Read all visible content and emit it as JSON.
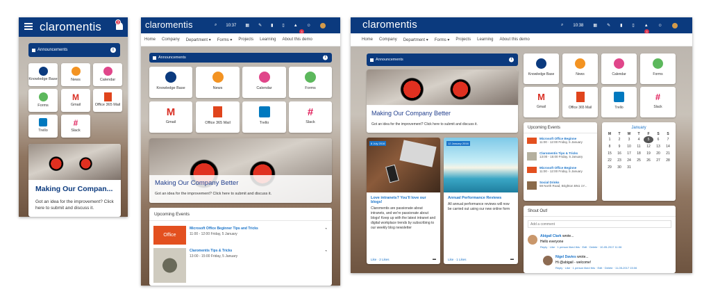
{
  "brand": "claromentis",
  "announcements": "Announcements",
  "nav": [
    "Home",
    "Company",
    "Department ▾",
    "Forms ▾",
    "Projects",
    "Learning",
    "About this demo"
  ],
  "date_label": "10:37",
  "date_label_2": "10:38",
  "apps": [
    "Knowledge Base",
    "News",
    "Calendar",
    "Forms",
    "Gmail",
    "Office 365 Mail",
    "Trello",
    "Slack"
  ],
  "mobile_hero_title": "Making Our Compan...",
  "hero_title": "Making Our Company Better",
  "hero_text": "Got an idea for the improvement? Click here to submit and discuss it.",
  "mobile_hero_text": "Got an idea for the improvement? Click here to submit and discuss it.",
  "upcoming_events": "Upcoming Events",
  "events": [
    {
      "title": "Microsoft Office Beginner Tips and Tricks",
      "time": "11:00 - 12:00 Friday, 5 January"
    },
    {
      "title": "Claromentis Tips & Tricks",
      "time": "13:00 - 15:00 Friday, 5 January"
    }
  ],
  "events_right": [
    {
      "title": "Microsoft Office Beginne",
      "time": "11:00 - 12:00 Friday, 5 January"
    },
    {
      "title": "Claromentis Tips & Tricks",
      "time": "13:00 - 15:00 Friday, 5 January"
    },
    {
      "title": "Microsoft Office Beginne",
      "time": "11:00 - 12:00 Friday, 5 January"
    },
    {
      "title": "Social Drinks",
      "time": "59 North Road, Brighton BN1 1Y..."
    }
  ],
  "office_logo": "Office",
  "calendar": {
    "month": "January",
    "days": [
      "M",
      "T",
      "W",
      "T",
      "F",
      "S",
      "S"
    ],
    "weeks": [
      [
        "1",
        "2",
        "3",
        "4",
        "5",
        "6",
        "7"
      ],
      [
        "8",
        "9",
        "10",
        "11",
        "12",
        "13",
        "14"
      ],
      [
        "15",
        "16",
        "17",
        "18",
        "19",
        "20",
        "21"
      ],
      [
        "22",
        "23",
        "24",
        "25",
        "26",
        "27",
        "28"
      ],
      [
        "29",
        "30",
        "31",
        "",
        "",
        "",
        ""
      ]
    ]
  },
  "blogs": [
    {
      "date": "8 July 2016",
      "title": "Love intranets? You'll love our blogs!",
      "text": "Claromentis are passionate about intranets, and we're passionate about blogs! Keep up with the latest intranet and digital workplace trends by subscribing to our weekly blog newsletter",
      "likes": "Like · 2 Likes"
    },
    {
      "date": "12 January 2016",
      "title": "Annual Performance Reviews",
      "text": "All annual performance reviews will now be carried out using our new online form",
      "likes": "Like · 1 Likes"
    }
  ],
  "shoutout": {
    "title": "Shout Out!",
    "placeholder": "Add a comment",
    "posts": [
      {
        "author": "Abigail Clark",
        "verb": "wrote...",
        "text": "Hello everyone",
        "meta": "Reply · Like · 1 person liked this · Edit · Delete · 10-05-2017 11:06"
      },
      {
        "author": "Nigel Davies",
        "verb": "wrote...",
        "text": "Hi @abigail - welcome!",
        "meta": "Reply · Like · 1 person liked this · Edit · Delete · 11-05-2017 15:06"
      }
    ]
  },
  "badge": "3"
}
